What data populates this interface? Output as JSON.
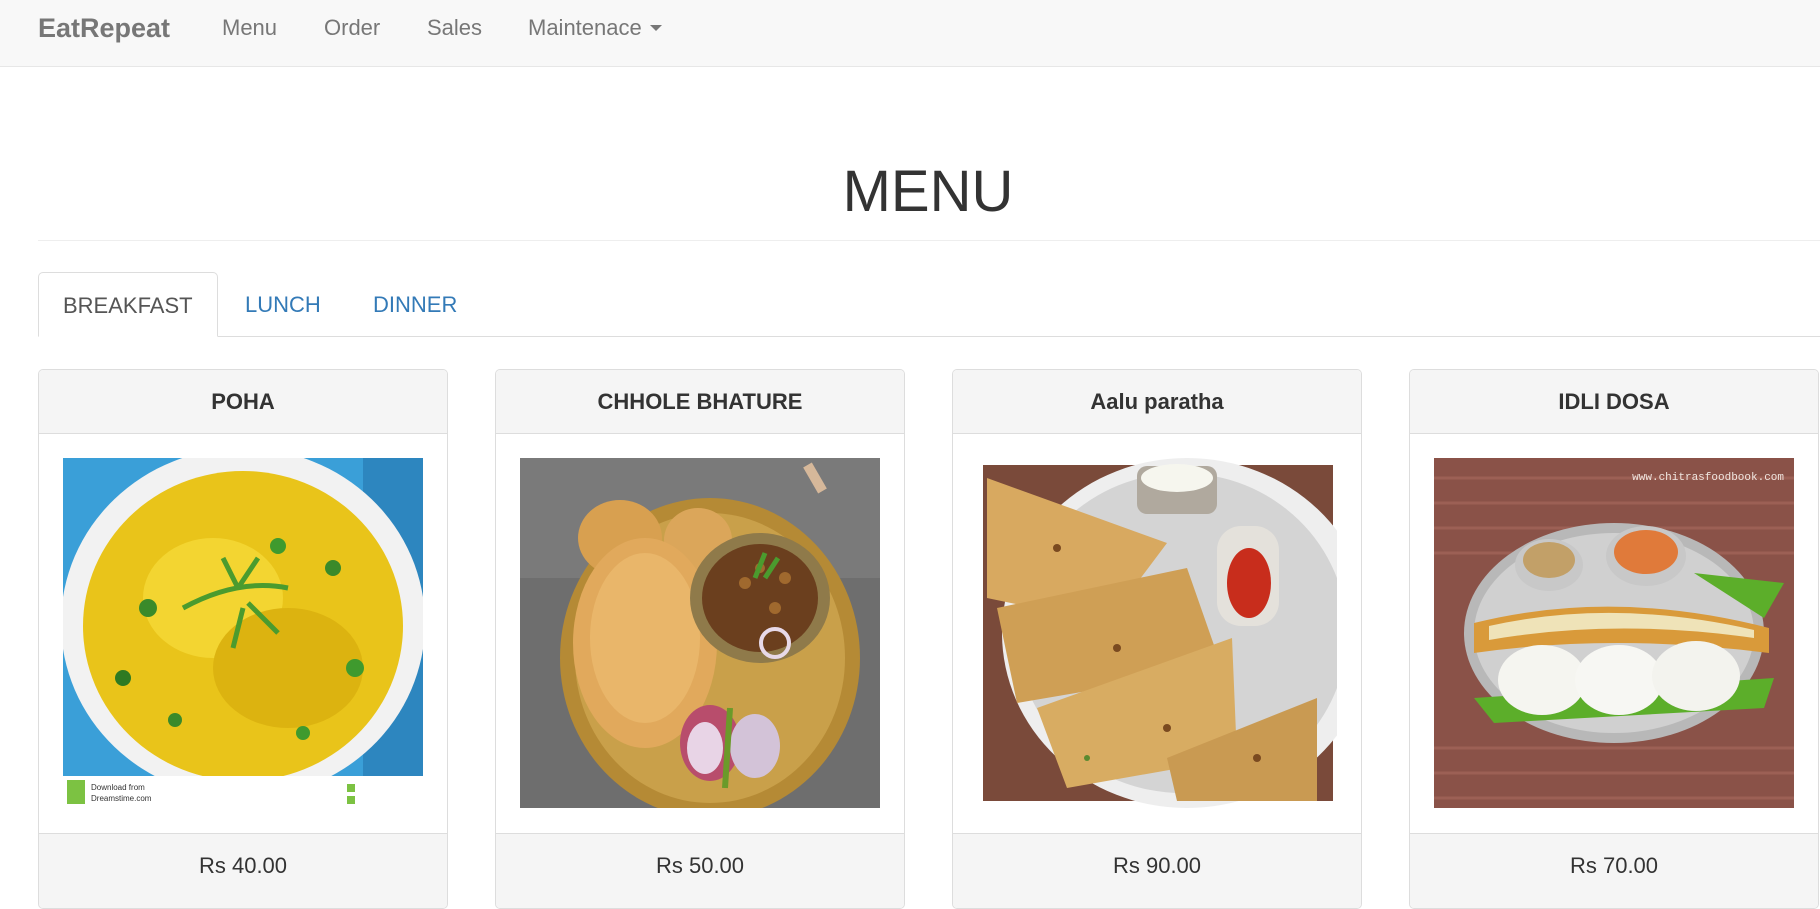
{
  "navbar": {
    "brand": "EatRepeat",
    "items": [
      {
        "label": "Menu"
      },
      {
        "label": "Order"
      },
      {
        "label": "Sales"
      },
      {
        "label": "Maintenace"
      }
    ]
  },
  "page": {
    "title": "MENU"
  },
  "tabs": [
    {
      "label": "BREAKFAST",
      "active": true
    },
    {
      "label": "LUNCH",
      "active": false
    },
    {
      "label": "DINNER",
      "active": false
    }
  ],
  "menu_items": [
    {
      "name": "POHA",
      "price": "Rs 40.00",
      "image_icon": "poha-photo"
    },
    {
      "name": "CHHOLE BHATURE",
      "price": "Rs 50.00",
      "image_icon": "chhole-bhature-photo"
    },
    {
      "name": "Aalu paratha",
      "price": "Rs 90.00",
      "image_icon": "aalu-paratha-photo"
    },
    {
      "name": "IDLI DOSA",
      "price": "Rs 70.00",
      "image_icon": "idli-dosa-photo"
    }
  ],
  "image_overlays": {
    "poha_watermark_line1": "Download from",
    "poha_watermark_line2": "Dreamstime.com",
    "idli_watermark": "www.chitrasfoodbook.com"
  },
  "colors": {
    "navbar_bg": "#f8f8f8",
    "link": "#337ab7",
    "muted": "#777777"
  }
}
